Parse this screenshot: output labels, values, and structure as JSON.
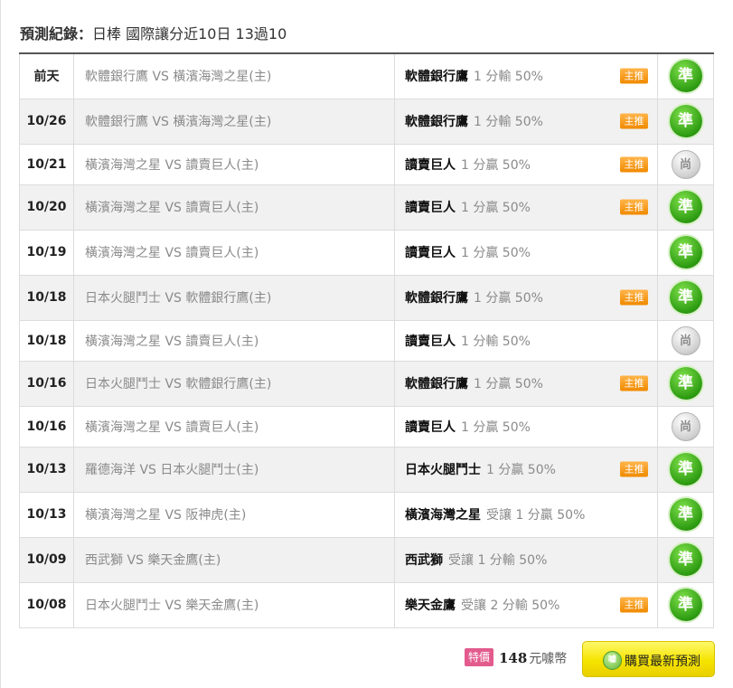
{
  "header": {
    "label": "預測紀錄：",
    "title": "日棒 國際讓分近10日 13過10"
  },
  "records": [
    {
      "date": "前天",
      "match": "軟體銀行鷹 VS 橫濱海灣之星(主)",
      "pick_team": "軟體銀行鷹",
      "pick_line": "1 分輸 50%",
      "tag": "主推",
      "result": "準",
      "result_type": "hit"
    },
    {
      "date": "10/26",
      "match": "軟體銀行鷹 VS 橫濱海灣之星(主)",
      "pick_team": "軟體銀行鷹",
      "pick_line": "1 分輸 50%",
      "tag": "主推",
      "result": "準",
      "result_type": "hit"
    },
    {
      "date": "10/21",
      "match": "橫濱海灣之星 VS 讀賣巨人(主)",
      "pick_team": "讀賣巨人",
      "pick_line": "1 分贏 50%",
      "tag": "主推",
      "result": "尚",
      "result_type": "miss"
    },
    {
      "date": "10/20",
      "match": "橫濱海灣之星 VS 讀賣巨人(主)",
      "pick_team": "讀賣巨人",
      "pick_line": "1 分贏 50%",
      "tag": "主推",
      "result": "準",
      "result_type": "hit"
    },
    {
      "date": "10/19",
      "match": "橫濱海灣之星 VS 讀賣巨人(主)",
      "pick_team": "讀賣巨人",
      "pick_line": "1 分贏 50%",
      "tag": "",
      "result": "準",
      "result_type": "hit"
    },
    {
      "date": "10/18",
      "match": "日本火腿鬥士 VS 軟體銀行鷹(主)",
      "pick_team": "軟體銀行鷹",
      "pick_line": "1 分贏 50%",
      "tag": "主推",
      "result": "準",
      "result_type": "hit"
    },
    {
      "date": "10/18",
      "match": "橫濱海灣之星 VS 讀賣巨人(主)",
      "pick_team": "讀賣巨人",
      "pick_line": "1 分輸 50%",
      "tag": "",
      "result": "尚",
      "result_type": "miss"
    },
    {
      "date": "10/16",
      "match": "日本火腿鬥士 VS 軟體銀行鷹(主)",
      "pick_team": "軟體銀行鷹",
      "pick_line": "1 分贏 50%",
      "tag": "主推",
      "result": "準",
      "result_type": "hit"
    },
    {
      "date": "10/16",
      "match": "橫濱海灣之星 VS 讀賣巨人(主)",
      "pick_team": "讀賣巨人",
      "pick_line": "1 分贏 50%",
      "tag": "",
      "result": "尚",
      "result_type": "miss"
    },
    {
      "date": "10/13",
      "match": "羅德海洋 VS 日本火腿鬥士(主)",
      "pick_team": "日本火腿鬥士",
      "pick_line": "1 分贏 50%",
      "tag": "主推",
      "result": "準",
      "result_type": "hit"
    },
    {
      "date": "10/13",
      "match": "橫濱海灣之星 VS 阪神虎(主)",
      "pick_team": "橫濱海灣之星",
      "pick_line": "受讓 1 分贏 50%",
      "tag": "",
      "result": "準",
      "result_type": "hit"
    },
    {
      "date": "10/09",
      "match": "西武獅 VS 樂天金鷹(主)",
      "pick_team": "西武獅",
      "pick_line": "受讓 1 分輸 50%",
      "tag": "",
      "result": "準",
      "result_type": "hit"
    },
    {
      "date": "10/08",
      "match": "日本火腿鬥士 VS 樂天金鷹(主)",
      "pick_team": "樂天金鷹",
      "pick_line": "受讓 2 分輸 50%",
      "tag": "主推",
      "result": "準",
      "result_type": "hit"
    }
  ],
  "footer": {
    "special_label": "特價",
    "price": "148",
    "currency": "元噱幣",
    "coin_text": "噱",
    "buy_label": "購買最新預測"
  },
  "colors": {
    "hit": "#2e9c12",
    "miss": "#a5a5a5",
    "tag": "#f08a00",
    "special": "#e35b8c",
    "buy_button": "#f5e400"
  }
}
